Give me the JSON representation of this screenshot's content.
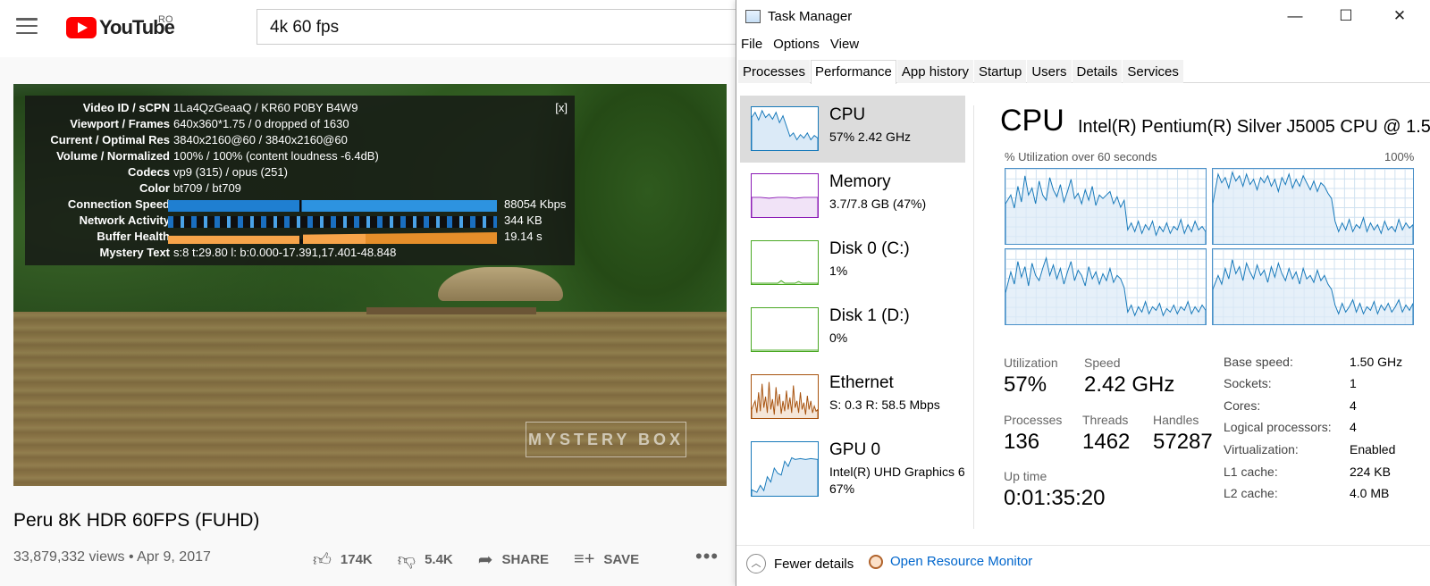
{
  "youtube": {
    "logo_text": "YouTube",
    "country": "RO",
    "search_value": "4k 60 fps",
    "stats": {
      "close": "[x]",
      "rows": [
        {
          "label": "Video ID / sCPN",
          "value": "1La4QzGeaaQ / KR60 P0BY B4W9"
        },
        {
          "label": "Viewport / Frames",
          "value": "640x360*1.75 / 0 dropped of 1630"
        },
        {
          "label": "Current / Optimal Res",
          "value": "3840x2160@60 / 3840x2160@60"
        },
        {
          "label": "Volume / Normalized",
          "value": "100% / 100% (content loudness -6.4dB)"
        },
        {
          "label": "Codecs",
          "value": "vp9 (315) / opus (251)"
        },
        {
          "label": "Color",
          "value": "bt709 / bt709"
        },
        {
          "label": "Connection Speed",
          "value": "88054 Kbps"
        },
        {
          "label": "Network Activity",
          "value": "344 KB"
        },
        {
          "label": "Buffer Health",
          "value": "19.14 s"
        },
        {
          "label": "Mystery Text",
          "value": "s:8 t:29.80 l: b:0.000-17.391,17.401-48.848"
        }
      ]
    },
    "watermark": "MYSTERY BOX",
    "video_title": "Peru 8K HDR 60FPS (FUHD)",
    "views": "33,879,332 views",
    "date": "Apr 9, 2017",
    "likes": "174K",
    "dislikes": "5.4K",
    "share": "SHARE",
    "save": "SAVE",
    "more": "•••"
  },
  "taskmanager": {
    "title": "Task Manager",
    "window_buttons": {
      "minimize": "—",
      "maximize": "☐",
      "close": "✕"
    },
    "menu": [
      "File",
      "Options",
      "View"
    ],
    "tabs": [
      "Processes",
      "Performance",
      "App history",
      "Startup",
      "Users",
      "Details",
      "Services"
    ],
    "active_tab": "Performance",
    "sidebar": [
      {
        "name": "CPU",
        "sub": "57% 2.42 GHz",
        "sub2": "",
        "color": "#1779ba"
      },
      {
        "name": "Memory",
        "sub": "3.7/7.8 GB (47%)",
        "sub2": "",
        "color": "#8b1ab5"
      },
      {
        "name": "Disk 0 (C:)",
        "sub": "1%",
        "sub2": "",
        "color": "#4aa823"
      },
      {
        "name": "Disk 1 (D:)",
        "sub": "0%",
        "sub2": "",
        "color": "#4aa823"
      },
      {
        "name": "Ethernet",
        "sub": "S: 0.3  R: 58.5 Mbps",
        "sub2": "",
        "color": "#a7520e"
      },
      {
        "name": "GPU 0",
        "sub": "Intel(R) UHD Graphics 6",
        "sub2": "67%",
        "color": "#1779ba"
      }
    ],
    "cpu_heading": "CPU",
    "cpu_model": "Intel(R) Pentium(R) Silver J5005 CPU @ 1.5...",
    "util_caption": "% Utilization over 60 seconds",
    "util_max": "100%",
    "stats": {
      "utilization_label": "Utilization",
      "utilization": "57%",
      "speed_label": "Speed",
      "speed": "2.42 GHz",
      "processes_label": "Processes",
      "processes": "136",
      "threads_label": "Threads",
      "threads": "1462",
      "handles_label": "Handles",
      "handles": "57287",
      "uptime_label": "Up time",
      "uptime": "0:01:35:20"
    },
    "specs": [
      {
        "label": "Base speed:",
        "value": "1.50 GHz"
      },
      {
        "label": "Sockets:",
        "value": "1"
      },
      {
        "label": "Cores:",
        "value": "4"
      },
      {
        "label": "Logical processors:",
        "value": "4"
      },
      {
        "label": "Virtualization:",
        "value": "Enabled"
      },
      {
        "label": "L1 cache:",
        "value": "224 KB"
      },
      {
        "label": "L2 cache:",
        "value": "4.0 MB"
      }
    ],
    "fewer_details": "Fewer details",
    "open_resource_monitor": "Open Resource Monitor"
  }
}
